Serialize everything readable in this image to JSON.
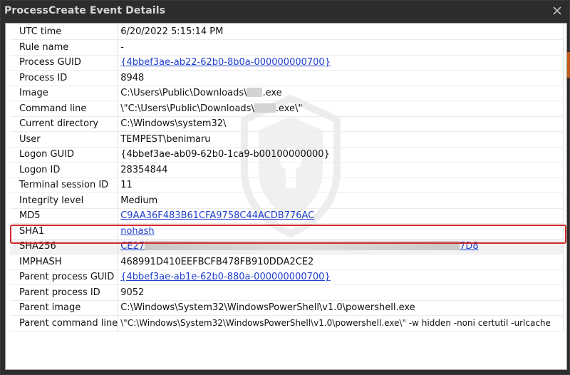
{
  "window": {
    "title": "ProcessCreate Event Details"
  },
  "colors": {
    "link": "#1f3fcc",
    "highlight": "#d12a2a"
  },
  "rows": [
    {
      "key": "UTC time",
      "value": "6/20/2022 5:15:14 PM"
    },
    {
      "key": "Rule name",
      "value": "-"
    },
    {
      "key": "Process GUID",
      "value": "{4bbef3ae-ab22-62b0-8b0a-000000000700}",
      "link": true
    },
    {
      "key": "Process ID",
      "value": "8948"
    },
    {
      "key": "Image",
      "value_pre": "C:\\Users\\Public\\Downloads\\",
      "value_post": ".exe"
    },
    {
      "key": "Command line",
      "value_pre": "\\\"C:\\Users\\Public\\Downloads\\",
      "value_post": ".exe\\\""
    },
    {
      "key": "Current directory",
      "value": "C:\\Windows\\system32\\"
    },
    {
      "key": "User",
      "value": "TEMPEST\\benimaru"
    },
    {
      "key": "Logon GUID",
      "value": "{4bbef3ae-ab09-62b0-1ca9-b00100000000}"
    },
    {
      "key": "Logon ID",
      "value": "28354844"
    },
    {
      "key": "Terminal session ID",
      "value": "11"
    },
    {
      "key": "Integrity level",
      "value": "Medium"
    },
    {
      "key": "MD5",
      "value": "C9AA36F483B61CFA9758C44ACDB776AC",
      "link": true
    },
    {
      "key": "SHA1",
      "value": "nohash",
      "link": true
    },
    {
      "key": "SHA256",
      "value_pre": "CE27",
      "value_post": "7D8",
      "link": true
    },
    {
      "key": "IMPHASH",
      "value": "468991D410EEFBCFB478FB910DDA2CE2"
    },
    {
      "key": "Parent process GUID",
      "value": "{4bbef3ae-ab1e-62b0-880a-000000000700}",
      "link": true
    },
    {
      "key": "Parent process ID",
      "value": "9052"
    },
    {
      "key": "Parent image",
      "value": "C:\\Windows\\System32\\WindowsPowerShell\\v1.0\\powershell.exe"
    },
    {
      "key": "Parent command line",
      "value": "\\\"C:\\Windows\\System32\\WindowsPowerShell\\v1.0\\powershell.exe\\\" -w hidden -noni certutil -urlcache"
    }
  ]
}
